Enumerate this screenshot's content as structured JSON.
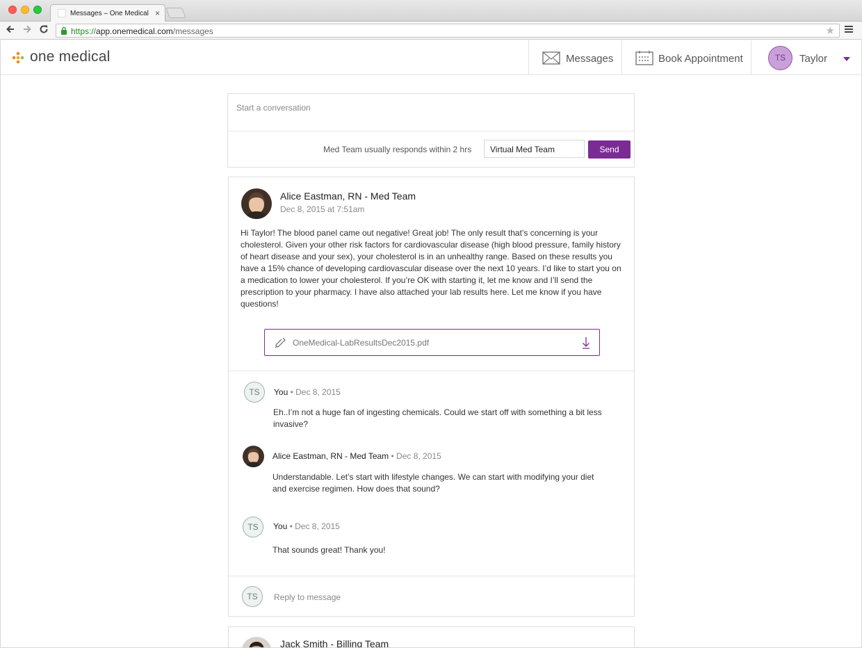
{
  "browser": {
    "tab_title": "Messages – One Medical",
    "tab_close": "×",
    "url_scheme": "https://",
    "url_host": "app.onemedical.com",
    "url_path": "/messages"
  },
  "header": {
    "logo_text": "one medical",
    "nav": {
      "messages_label": "Messages",
      "book_label": "Book Appointment",
      "user_initials": "TS",
      "user_name": "Taylor"
    }
  },
  "compose": {
    "placeholder": "Start a conversation",
    "hint": "Med Team usually responds within 2 hrs",
    "team_value": "Virtual Med Team",
    "send_label": "Send"
  },
  "thread": {
    "author": "Alice Eastman, RN - Med Team",
    "date": "Dec 8, 2015 at 7:51am",
    "body": "Hi Taylor! The blood panel came out negative! Great job! The only result that’s concerning is your cholesterol. Given your other risk factors for cardiovascular disease (high blood pressure, family history of heart disease and your sex), your cholesterol is in an unhealthy range. Based on these results you have a 15% chance of developing cardiovascular disease over the next 10 years. I’d like to start you on a medication to lower your cholesterol. If you’re OK with starting it, let me know and I’ll send the prescription to your pharmacy. I have also attached your lab results here. Let me know if you have questions!",
    "attachment": "OneMedical-LabResultsDec2015.pdf",
    "replies": [
      {
        "initials": "TS",
        "name": "You",
        "date": "• Dec 8, 2015",
        "text": "Eh..I’m not a huge fan of ingesting chemicals. Could we start off with something a bit less invasive?"
      },
      {
        "initials": "",
        "name": "Alice Eastman, RN - Med Team",
        "date": "• Dec 8, 2015",
        "text": "Understandable. Let’s start with lifestyle changes. We can start with modifying your diet and exercise regimen. How does that sound?"
      },
      {
        "initials": "TS",
        "name": "You",
        "date": "• Dec 8, 2015",
        "text": "That sounds great! Thank you!"
      }
    ],
    "reply_initials": "TS",
    "reply_placeholder": "Reply to message"
  },
  "next_thread": {
    "author": "Jack Smith - Billing Team"
  },
  "colors": {
    "brand_purple": "#7b2c94",
    "logo_orange": "#f08a24",
    "logo_green": "#8bc34a"
  },
  "icons": [
    "lock-icon",
    "star-icon",
    "menu-icon",
    "envelope-icon",
    "calendar-icon",
    "chevron-down-icon",
    "paperclip-icon",
    "download-icon"
  ]
}
